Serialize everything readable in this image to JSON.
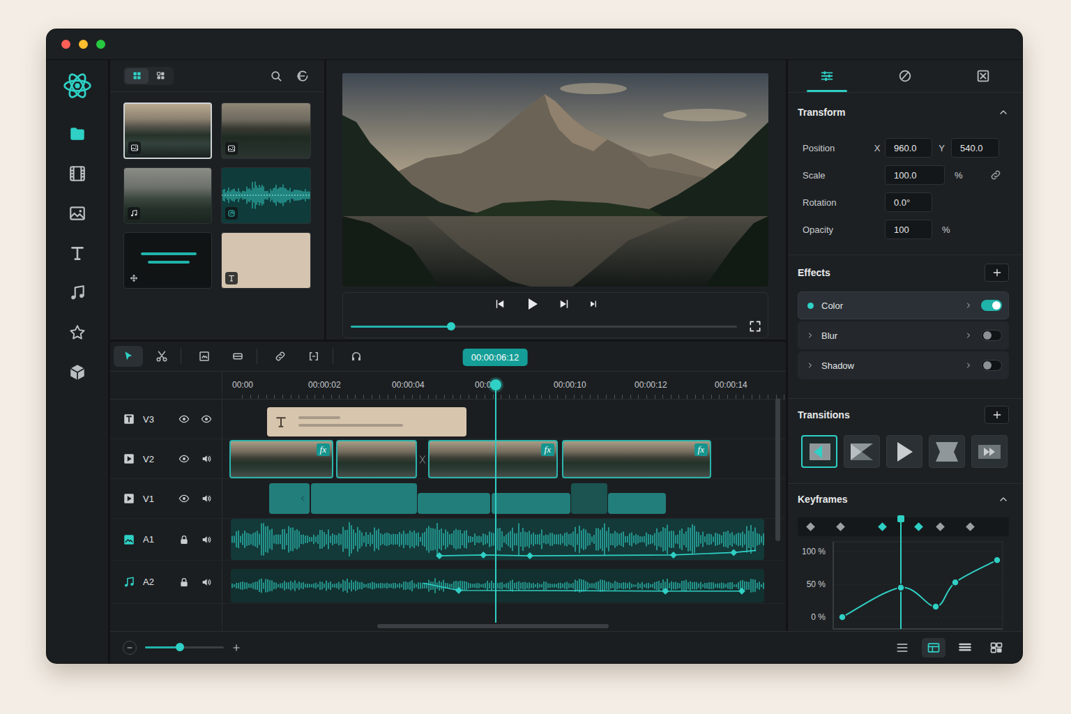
{
  "window": {
    "controls": [
      {
        "color": "#ff5f57"
      },
      {
        "color": "#febc2e"
      },
      {
        "color": "#28c840"
      }
    ]
  },
  "sidebar": {
    "items": [
      {
        "selected": true
      },
      {
        "selected": false
      },
      {
        "selected": false
      },
      {
        "selected": false
      },
      {
        "selected": false
      },
      {
        "selected": false
      },
      {
        "selected": false
      }
    ]
  },
  "media": {
    "views": [
      {
        "selected": true
      },
      {
        "selected": false
      }
    ],
    "items": [
      {
        "kind": "image",
        "selected": true
      },
      {
        "kind": "image",
        "selected": false
      },
      {
        "kind": "music",
        "selected": false
      },
      {
        "kind": "waveform",
        "selected": false
      },
      {
        "kind": "motion",
        "selected": false
      },
      {
        "kind": "text",
        "selected": false
      }
    ]
  },
  "preview": {
    "level": 0.26
  },
  "timeline": {
    "tools": [
      {
        "selected": true
      },
      {
        "selected": false
      },
      {
        "selected": false
      },
      {
        "selected": false
      },
      {
        "selected": false
      },
      {
        "selected": false
      },
      {
        "selected": false
      }
    ],
    "timecode": "00:00:06:12",
    "ruler": [
      "00:00",
      "00:00:02",
      "00:00:04",
      "00:0",
      "00:00:10",
      "00:00:12",
      "00:00:14"
    ],
    "tracks": [
      {
        "label": "V3",
        "kind": "text",
        "selected": false,
        "clips": [
          {
            "kind": "title"
          }
        ]
      },
      {
        "label": "V2",
        "kind": "video",
        "selected": false,
        "clips": [
          {
            "kind": "video",
            "badge": "fx",
            "transition": false
          },
          {
            "kind": "video",
            "badge": null,
            "transition": true
          },
          {
            "kind": "video",
            "badge": "fx",
            "transition": false
          },
          {
            "kind": "video",
            "badge": "fx",
            "transition": false
          }
        ]
      },
      {
        "label": "V1",
        "kind": "video",
        "selected": false,
        "clips": [
          {
            "kind": "edge"
          },
          {
            "kind": "block"
          },
          {
            "kind": "low"
          },
          {
            "kind": "low"
          },
          {
            "kind": "dark"
          },
          {
            "kind": "low"
          }
        ]
      },
      {
        "label": "A1",
        "kind": "audio",
        "selected": true,
        "clips": [
          {
            "kind": "waveform",
            "envelope": [
              {
                "t": 4.88,
                "level": 0.1,
                "marker": true
              },
              {
                "t": 5.97,
                "level": 0.12,
                "marker": true
              },
              {
                "t": 7.12,
                "level": 0.1,
                "marker": true
              },
              {
                "t": 10.67,
                "level": 0.12,
                "marker": true
              },
              {
                "t": 12.16,
                "level": 0.18,
                "marker": true
              },
              {
                "t": 12.71,
                "level": 0.23,
                "marker": false
              }
            ]
          }
        ]
      },
      {
        "label": "A2",
        "kind": "music",
        "selected": false,
        "clips": [
          {
            "kind": "waveform",
            "envelope": [
              {
                "t": 4.48,
                "level": 0.58,
                "marker": false
              },
              {
                "t": 5.36,
                "level": 0.36,
                "marker": true
              },
              {
                "t": 10.47,
                "level": 0.34,
                "marker": true
              },
              {
                "t": 12.36,
                "level": 0.34,
                "marker": true
              }
            ]
          }
        ]
      }
    ]
  },
  "inspector": {
    "tabs": [
      {
        "selected": true
      },
      {
        "selected": false
      },
      {
        "selected": false
      }
    ],
    "transform": {
      "title": "Transform",
      "expanded": true,
      "rows": [
        {
          "label": "Position",
          "kind": "xy",
          "x_label": "X",
          "x": "960.0",
          "y_label": "Y",
          "y": "540.0"
        },
        {
          "label": "Scale",
          "kind": "linked",
          "value": "100.0",
          "unit": "%"
        },
        {
          "label": "Rotation",
          "kind": "plain",
          "value": "0.0°"
        },
        {
          "label": "Opacity",
          "kind": "unit",
          "value": "100",
          "unit": "%"
        }
      ]
    },
    "effects": {
      "title": "Effects",
      "items": [
        {
          "label": "Color",
          "selected": true,
          "on": true
        },
        {
          "label": "Blur",
          "selected": false,
          "on": false
        },
        {
          "label": "Shadow",
          "selected": false,
          "on": false
        }
      ]
    },
    "transitions": {
      "title": "Transitions",
      "items": [
        {
          "selected": true
        },
        {
          "selected": false
        },
        {
          "selected": false
        },
        {
          "selected": false
        },
        {
          "selected": false
        }
      ]
    },
    "keyframes": {
      "title": "Keyframes",
      "expanded": true,
      "markers": [
        {
          "selected": false
        },
        {
          "selected": false
        },
        {
          "selected": true
        },
        {
          "selected": true
        },
        {
          "selected": false
        },
        {
          "selected": false
        }
      ],
      "ticks": [
        "100 %",
        "50 %",
        "0 %"
      ],
      "values": [
        0,
        45,
        16,
        53,
        87
      ]
    }
  },
  "zoom": {
    "level": 0.44
  },
  "layouts": [
    {
      "selected": false
    },
    {
      "selected": true
    },
    {
      "selected": false
    },
    {
      "selected": false
    }
  ]
}
